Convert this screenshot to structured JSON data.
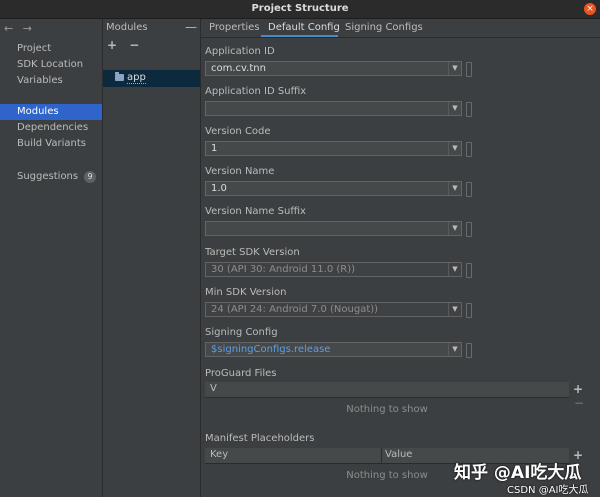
{
  "window": {
    "title": "Project Structure",
    "close": "×"
  },
  "nav": {
    "back": "←",
    "forward": "→"
  },
  "sidebar": {
    "items": [
      {
        "label": "Project"
      },
      {
        "label": "SDK Location"
      },
      {
        "label": "Variables"
      },
      {
        "label": "Modules"
      },
      {
        "label": "Dependencies"
      },
      {
        "label": "Build Variants"
      },
      {
        "label": "Suggestions"
      }
    ],
    "suggestions_count": "9",
    "selected": "Modules"
  },
  "modules": {
    "header": "Modules",
    "collapse": "—",
    "add": "+",
    "remove": "−",
    "items": [
      "app"
    ]
  },
  "tabs": [
    {
      "label": "Properties"
    },
    {
      "label": "Default Config"
    },
    {
      "label": "Signing Configs"
    }
  ],
  "active_tab": "Default Config",
  "fields": {
    "application_id": {
      "label": "Application ID",
      "value": "com.cv.tnn"
    },
    "application_id_suffix": {
      "label": "Application ID Suffix",
      "value": ""
    },
    "version_code": {
      "label": "Version Code",
      "value": "1"
    },
    "version_name": {
      "label": "Version Name",
      "value": "1.0"
    },
    "version_name_suffix": {
      "label": "Version Name Suffix",
      "value": ""
    },
    "target_sdk": {
      "label": "Target SDK Version",
      "value": "30",
      "hint": "(API 30: Android 11.0 (R))"
    },
    "min_sdk": {
      "label": "Min SDK Version",
      "value": "24",
      "hint": "(API 24: Android 7.0 (Nougat))"
    },
    "signing_config": {
      "label": "Signing Config",
      "value": "$signingConfigs.release"
    }
  },
  "proguard": {
    "label": "ProGuard Files",
    "column": "V",
    "empty": "Nothing to show",
    "add": "+",
    "remove": "−"
  },
  "manifest": {
    "label": "Manifest Placeholders",
    "columns": [
      "Key",
      "Value"
    ],
    "empty": "Nothing to show",
    "add": "+"
  },
  "watermark": {
    "main": "知乎 @AI吃大瓜",
    "sub": "CSDN @AI吃大瓜"
  }
}
